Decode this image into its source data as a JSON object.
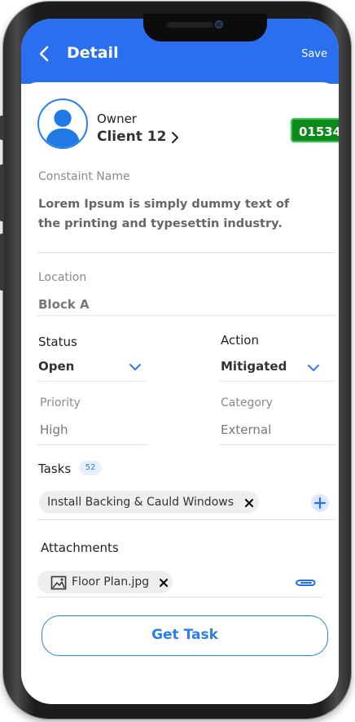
{
  "header": {
    "title": "Detail",
    "save_label": "Save",
    "color": "#2a6ff0"
  },
  "owner": {
    "label": "Owner",
    "name": "Client 12",
    "id_badge": "01534",
    "badge_color": "#0e8a1c"
  },
  "complaint": {
    "label": "Constaint Name",
    "text": "Lorem Ipsum is simply dummy text of the printing and typesettin industry."
  },
  "location": {
    "label": "Location",
    "value": "Block A"
  },
  "status": {
    "label": "Status",
    "value": "Open"
  },
  "action": {
    "label": "Action",
    "value": "Mitigated"
  },
  "priority": {
    "label": "Priority",
    "value": "High"
  },
  "category": {
    "label": "Category",
    "value": "External"
  },
  "tasks": {
    "label": "Tasks",
    "count": "52",
    "items": [
      "Install Backing & Cauld Windows"
    ]
  },
  "attachments": {
    "label": "Attachments",
    "items": [
      "Floor Plan.jpg"
    ]
  },
  "get_task_label": "Get Task",
  "icons": [
    "back-icon",
    "avatar-icon",
    "chevron-right-icon",
    "chevron-down-icon",
    "close-icon",
    "plus-icon",
    "image-icon",
    "paperclip-icon"
  ]
}
